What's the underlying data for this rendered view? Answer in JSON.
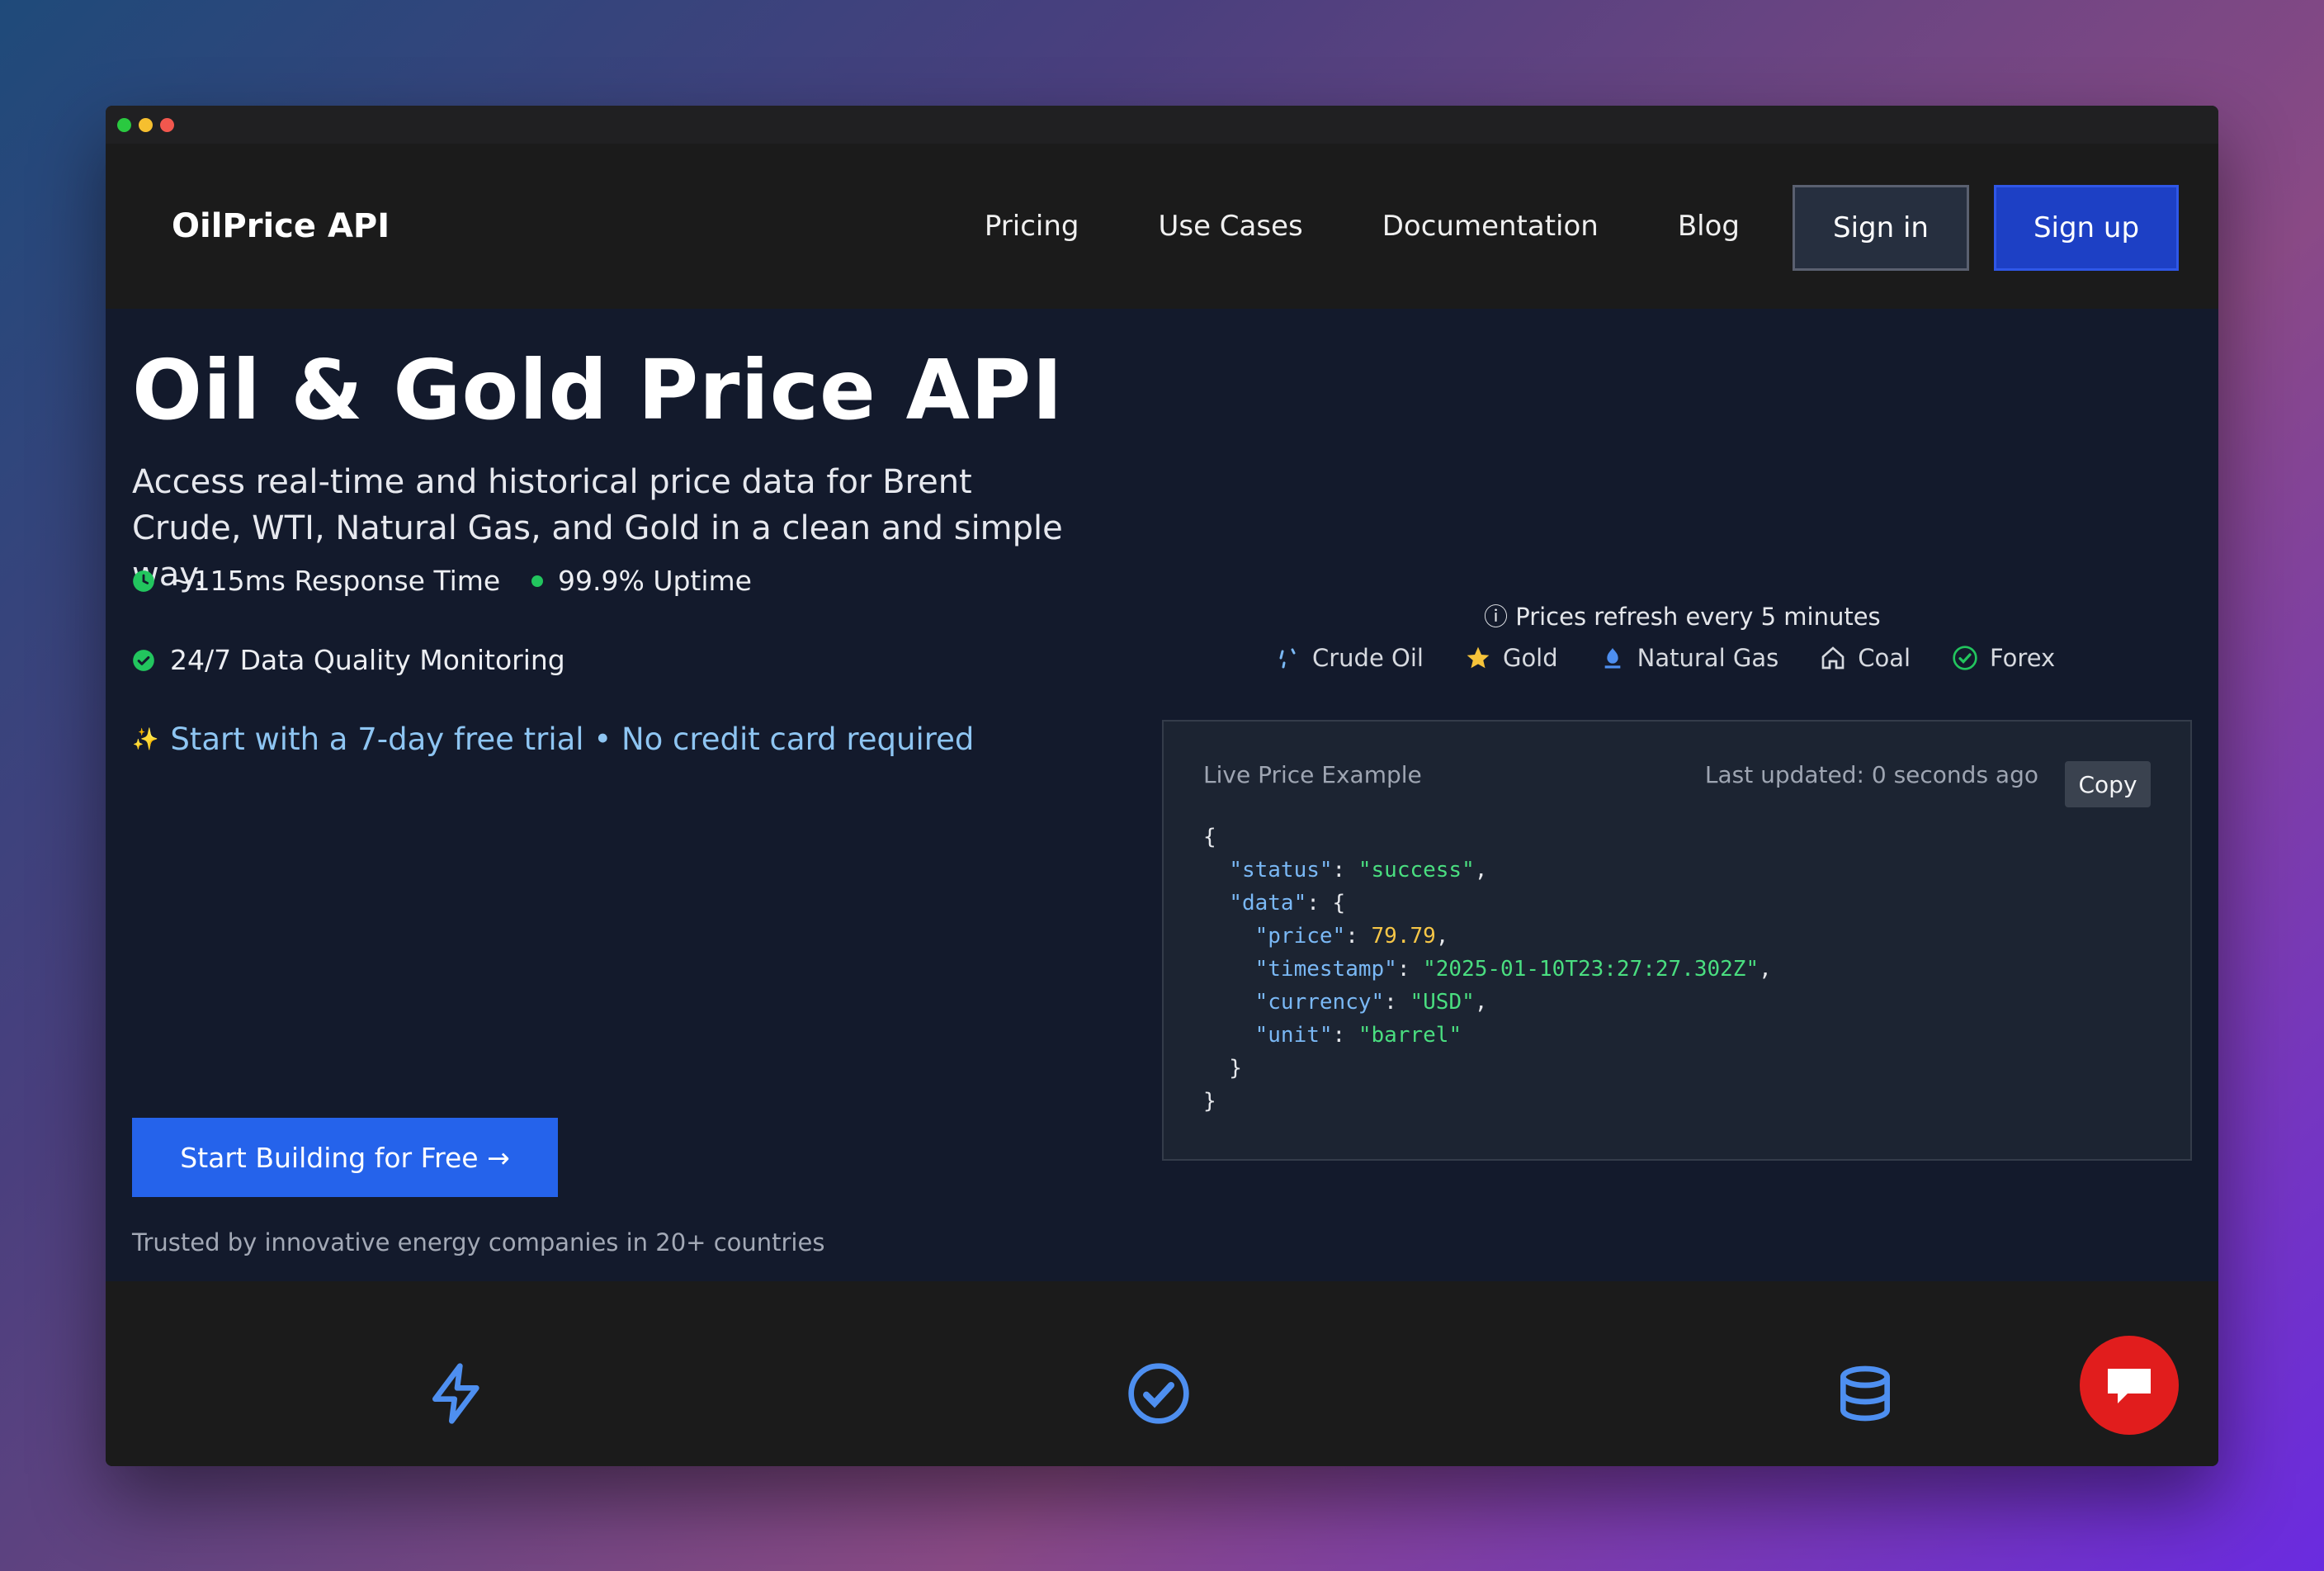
{
  "window": {
    "controls": [
      "close",
      "minimize",
      "zoom"
    ]
  },
  "nav": {
    "brand": "OilPrice API",
    "links": [
      "Pricing",
      "Use Cases",
      "Documentation",
      "Blog"
    ],
    "signin": "Sign in",
    "signup": "Sign up"
  },
  "hero": {
    "title": "Oil & Gold Price API",
    "subtitle": "Access real-time and historical price data for Brent Crude, WTI, Natural Gas, and Gold in a clean and simple way.",
    "stats": {
      "response_time": "~115ms Response Time",
      "uptime": "99.9% Uptime",
      "monitoring": "24/7 Data Quality Monitoring"
    },
    "trial": "Start with a 7-day free trial • No credit card required",
    "cta": "Start Building for Free →",
    "trusted": "Trusted by innovative energy companies in 20+ countries"
  },
  "prices": {
    "refresh": "ⓘ Prices refresh every 5 minutes",
    "assets": [
      {
        "label": "Crude Oil",
        "icon": "oil-drop-icon"
      },
      {
        "label": "Gold",
        "icon": "star-icon"
      },
      {
        "label": "Natural Gas",
        "icon": "flame-icon"
      },
      {
        "label": "Coal",
        "icon": "house-icon"
      },
      {
        "label": "Forex",
        "icon": "check-circle-icon"
      }
    ]
  },
  "code_panel": {
    "title": "Live Price Example",
    "updated": "Last updated: 0 seconds ago",
    "copy": "Copy",
    "json": {
      "status": "success",
      "price": "79.79",
      "timestamp": "2025-01-10T23:27:27.302Z",
      "currency": "USD",
      "unit": "barrel"
    }
  },
  "features": {
    "icons": [
      "bolt-icon",
      "check-circle-icon",
      "database-icon"
    ]
  },
  "colors": {
    "accent": "#2563eb",
    "signup": "#1d40c5",
    "success": "#22c55e",
    "chat": "#e11d1d",
    "link": "#8ec5f2"
  }
}
